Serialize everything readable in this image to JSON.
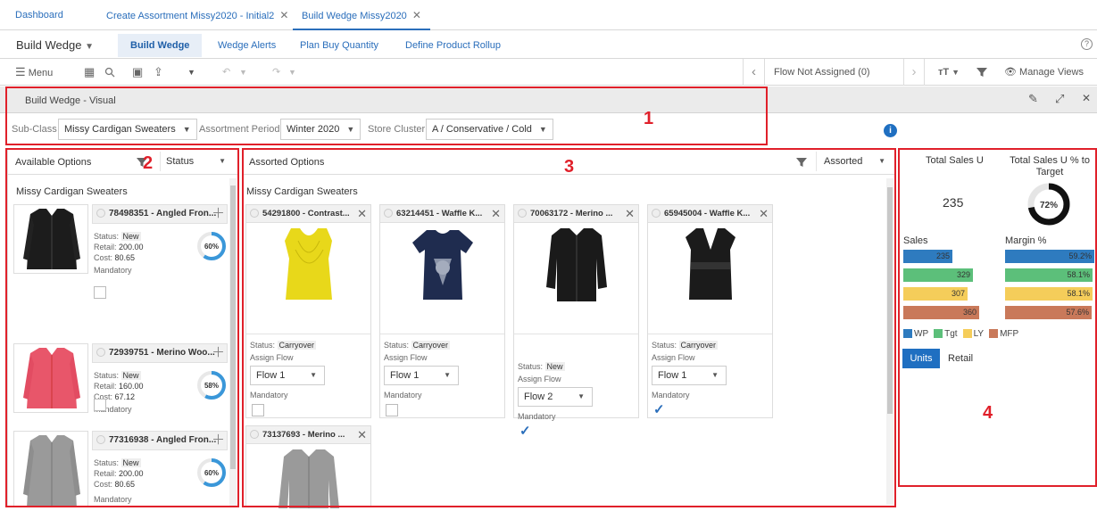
{
  "tabs": {
    "dashboard": "Dashboard",
    "tab1": "Create Assortment Missy2020 - Initial2",
    "tab2": "Build Wedge Missy2020",
    "close": "✕"
  },
  "nav": {
    "title": "Build Wedge",
    "items": [
      "Build Wedge",
      "Wedge Alerts",
      "Plan Buy Quantity",
      "Define Product Rollup"
    ],
    "help": "?"
  },
  "toolbar": {
    "menu": "Menu",
    "flow": "Flow Not Assigned (0)",
    "manage_views": "Manage Views"
  },
  "visual": {
    "title": "Build Wedge - Visual"
  },
  "filters": {
    "subclass_label": "Sub-Class",
    "subclass_value": "Missy Cardigan Sweaters",
    "period_label": "Assortment Period",
    "period_value": "Winter 2020",
    "cluster_label": "Store Cluster",
    "cluster_value": "A / Conservative / Cold"
  },
  "available": {
    "title": "Available Options",
    "filter_value": "Status",
    "group": "Missy Cardigan Sweaters",
    "status_label": "Status:",
    "retail_label": "Retail:",
    "cost_label": "Cost:",
    "mandatory_label": "Mandatory",
    "items": [
      {
        "name": "78498351 - Angled Fron...",
        "status": "New",
        "retail": "200.00",
        "cost": "80.65",
        "pct": "60%",
        "pct_value": 0.6
      },
      {
        "name": "72939751 - Merino Woo...",
        "status": "New",
        "retail": "160.00",
        "cost": "67.12",
        "pct": "58%",
        "pct_value": 0.58
      },
      {
        "name": "77316938 - Angled Fron...",
        "status": "New",
        "retail": "200.00",
        "cost": "80.65",
        "pct": "60%",
        "pct_value": 0.6
      }
    ]
  },
  "assorted": {
    "title": "Assorted Options",
    "filter_value": "Assorted",
    "group": "Missy Cardigan Sweaters",
    "status_label": "Status:",
    "assign_label": "Assign Flow",
    "mandatory_label": "Mandatory",
    "items": [
      {
        "name": "54291800 - Contrast...",
        "status": "Carryover",
        "flow": "Flow 1",
        "mandatory": false
      },
      {
        "name": "63214451 - Waffle K...",
        "status": "Carryover",
        "flow": "Flow 1",
        "mandatory": false
      },
      {
        "name": "70063172 - Merino ...",
        "status": "New",
        "flow": "Flow 2",
        "mandatory": true
      },
      {
        "name": "65945004 - Waffle K...",
        "status": "Carryover",
        "flow": "Flow 1",
        "mandatory": true
      },
      {
        "name": "73137693 - Merino ..."
      }
    ]
  },
  "summary": {
    "total_sales_label": "Total Sales U",
    "total_sales_value": "235",
    "pct_target_label": "Total Sales U % to Target",
    "pct_target_value": "72%",
    "pct_target_fraction": 0.72,
    "sales_label": "Sales",
    "margin_label": "Margin %",
    "sales_values": [
      "235",
      "329",
      "307",
      "360"
    ],
    "sales_numbers": [
      235,
      329,
      307,
      360
    ],
    "margin_values": [
      "59.2%",
      "58.1%",
      "58.1%",
      "57.6%"
    ],
    "legend": [
      "WP",
      "Tgt",
      "LY",
      "MFP"
    ],
    "colors": [
      "#2e7bbf",
      "#5cbf7a",
      "#f5cd5a",
      "#c9795a"
    ],
    "units_button": "Units",
    "retail_button": "Retail"
  },
  "callouts": [
    "1",
    "2",
    "3",
    "4"
  ],
  "accent": "#2a6ebb",
  "highlight": "#e0202a"
}
